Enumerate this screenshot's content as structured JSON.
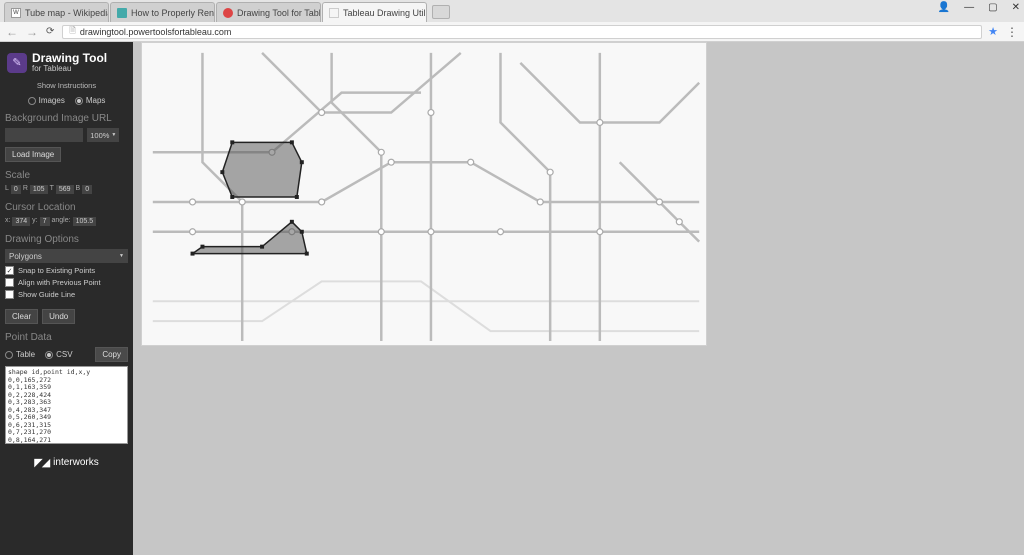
{
  "browser": {
    "tabs": [
      {
        "title": "Tube map - Wikipedia"
      },
      {
        "title": "How to Properly Render"
      },
      {
        "title": "Drawing Tool for Tablea"
      },
      {
        "title": "Tableau Drawing Utility b"
      }
    ],
    "url": "drawingtool.powertoolsfortableau.com"
  },
  "sidebar": {
    "logo": {
      "title": "Drawing Tool",
      "subtitle": "for Tableau"
    },
    "show_instructions": "Show Instructions",
    "mode": {
      "images_label": "Images",
      "maps_label": "Maps",
      "selected": "Maps"
    },
    "bg_url": {
      "header": "Background Image URL",
      "zoom": "100%",
      "load_btn": "Load Image"
    },
    "scale": {
      "header": "Scale",
      "items": [
        {
          "lbl": "L",
          "val": "0"
        },
        {
          "lbl": "R",
          "val": "105"
        },
        {
          "lbl": "T",
          "val": "569"
        },
        {
          "lbl": "B",
          "val": "0"
        }
      ]
    },
    "cursor": {
      "header": "Cursor Location",
      "items": [
        {
          "lbl": "x:",
          "val": "374"
        },
        {
          "lbl": "y:",
          "val": "7"
        },
        {
          "lbl": "angle:",
          "val": "105.5"
        }
      ]
    },
    "drawing": {
      "header": "Drawing Options",
      "shape_type": "Polygons",
      "snap_label": "Snap to Existing Points",
      "snap_checked": true,
      "align_label": "Align with Previous Point",
      "align_checked": false,
      "guide_label": "Show Guide Line",
      "guide_checked": false,
      "clear_btn": "Clear",
      "undo_btn": "Undo"
    },
    "point_data": {
      "header": "Point Data",
      "table_label": "Table",
      "csv_label": "CSV",
      "selected": "CSV",
      "copy_btn": "Copy",
      "content": "shape id,point id,x,y\n0,0,165,272\n0,1,163,359\n0,2,228,424\n0,3,283,363\n0,4,283,347\n0,5,260,349\n0,6,231,315\n0,7,231,270\n0,8,164,271"
    },
    "footer": "interworks"
  }
}
